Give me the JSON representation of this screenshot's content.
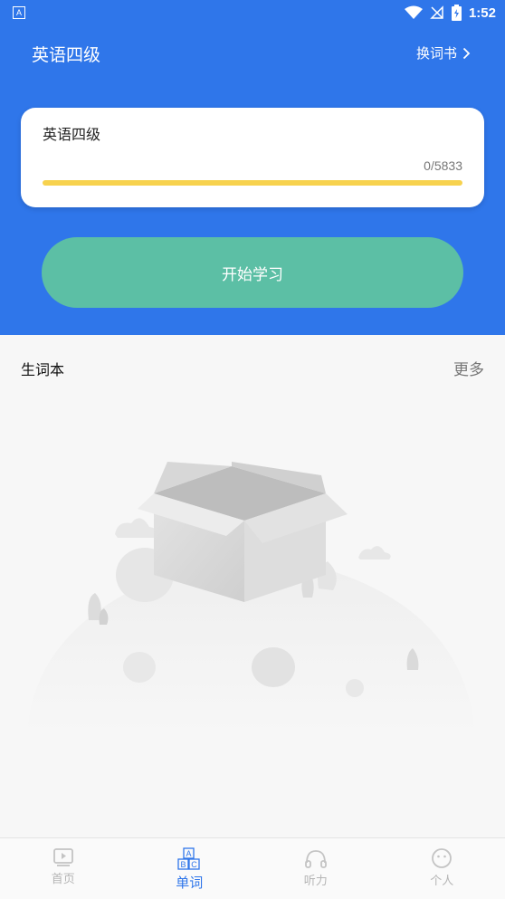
{
  "status_bar": {
    "time": "1:52"
  },
  "header": {
    "title": "英语四级",
    "switch_book_label": "换词书"
  },
  "book_card": {
    "name": "英语四级",
    "learned": 0,
    "total": 5833,
    "progress_text": "0/5833"
  },
  "start_button_label": "开始学习",
  "vocab_section": {
    "title": "生词本",
    "more_label": "更多"
  },
  "tabs": [
    {
      "label": "首页",
      "icon": "play-icon"
    },
    {
      "label": "单词",
      "icon": "abc-blocks-icon",
      "active": true
    },
    {
      "label": "听力",
      "icon": "headphones-icon"
    },
    {
      "label": "个人",
      "icon": "face-icon"
    }
  ],
  "colors": {
    "primary": "#2f76ea",
    "start_button": "#5cbfa5",
    "progress_track": "#f7d24e"
  }
}
